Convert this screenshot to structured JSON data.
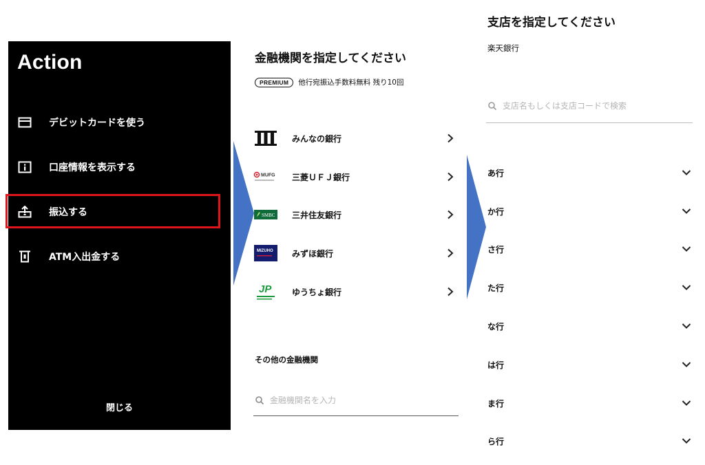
{
  "action_menu": {
    "title": "Action",
    "items": [
      {
        "label": "デビットカードを使う",
        "icon": "card-icon"
      },
      {
        "label": "口座情報を表示する",
        "icon": "info-icon"
      },
      {
        "label": "振込する",
        "icon": "upload-tray-icon"
      },
      {
        "label": "ATM入出金する",
        "icon": "atm-icon"
      }
    ],
    "highlight_color": "#e0141b",
    "close_label": "閉じる"
  },
  "bank_select": {
    "title": "金融機関を指定してください",
    "premium_badge": "PREMIUM",
    "premium_text": "他行宛振込手数料無料 残り10回",
    "banks": [
      {
        "name": "みんなの銀行",
        "logo": "minna-bank-logo"
      },
      {
        "name": "三菱ＵＦＪ銀行",
        "logo": "mufg-logo",
        "logo_text": "MUFG"
      },
      {
        "name": "三井住友銀行",
        "logo": "smbc-logo",
        "logo_text": "SMBC"
      },
      {
        "name": "みずほ銀行",
        "logo": "mizuho-logo",
        "logo_text": "MIZUHO"
      },
      {
        "name": "ゆうちょ銀行",
        "logo": "japan-post-bank-logo",
        "logo_text": "JP"
      }
    ],
    "other_title": "その他の金融機関",
    "search_placeholder": "金融機関名を入力"
  },
  "branch_select": {
    "title": "支店を指定してください",
    "selected_bank": "楽天銀行",
    "search_placeholder": "支店名もしくは支店コードで検索",
    "rows": [
      "あ行",
      "か行",
      "さ行",
      "た行",
      "な行",
      "は行",
      "ま行",
      "ら行"
    ]
  },
  "colors": {
    "arrow": "#4472c4",
    "panel_bg": "#000000"
  }
}
